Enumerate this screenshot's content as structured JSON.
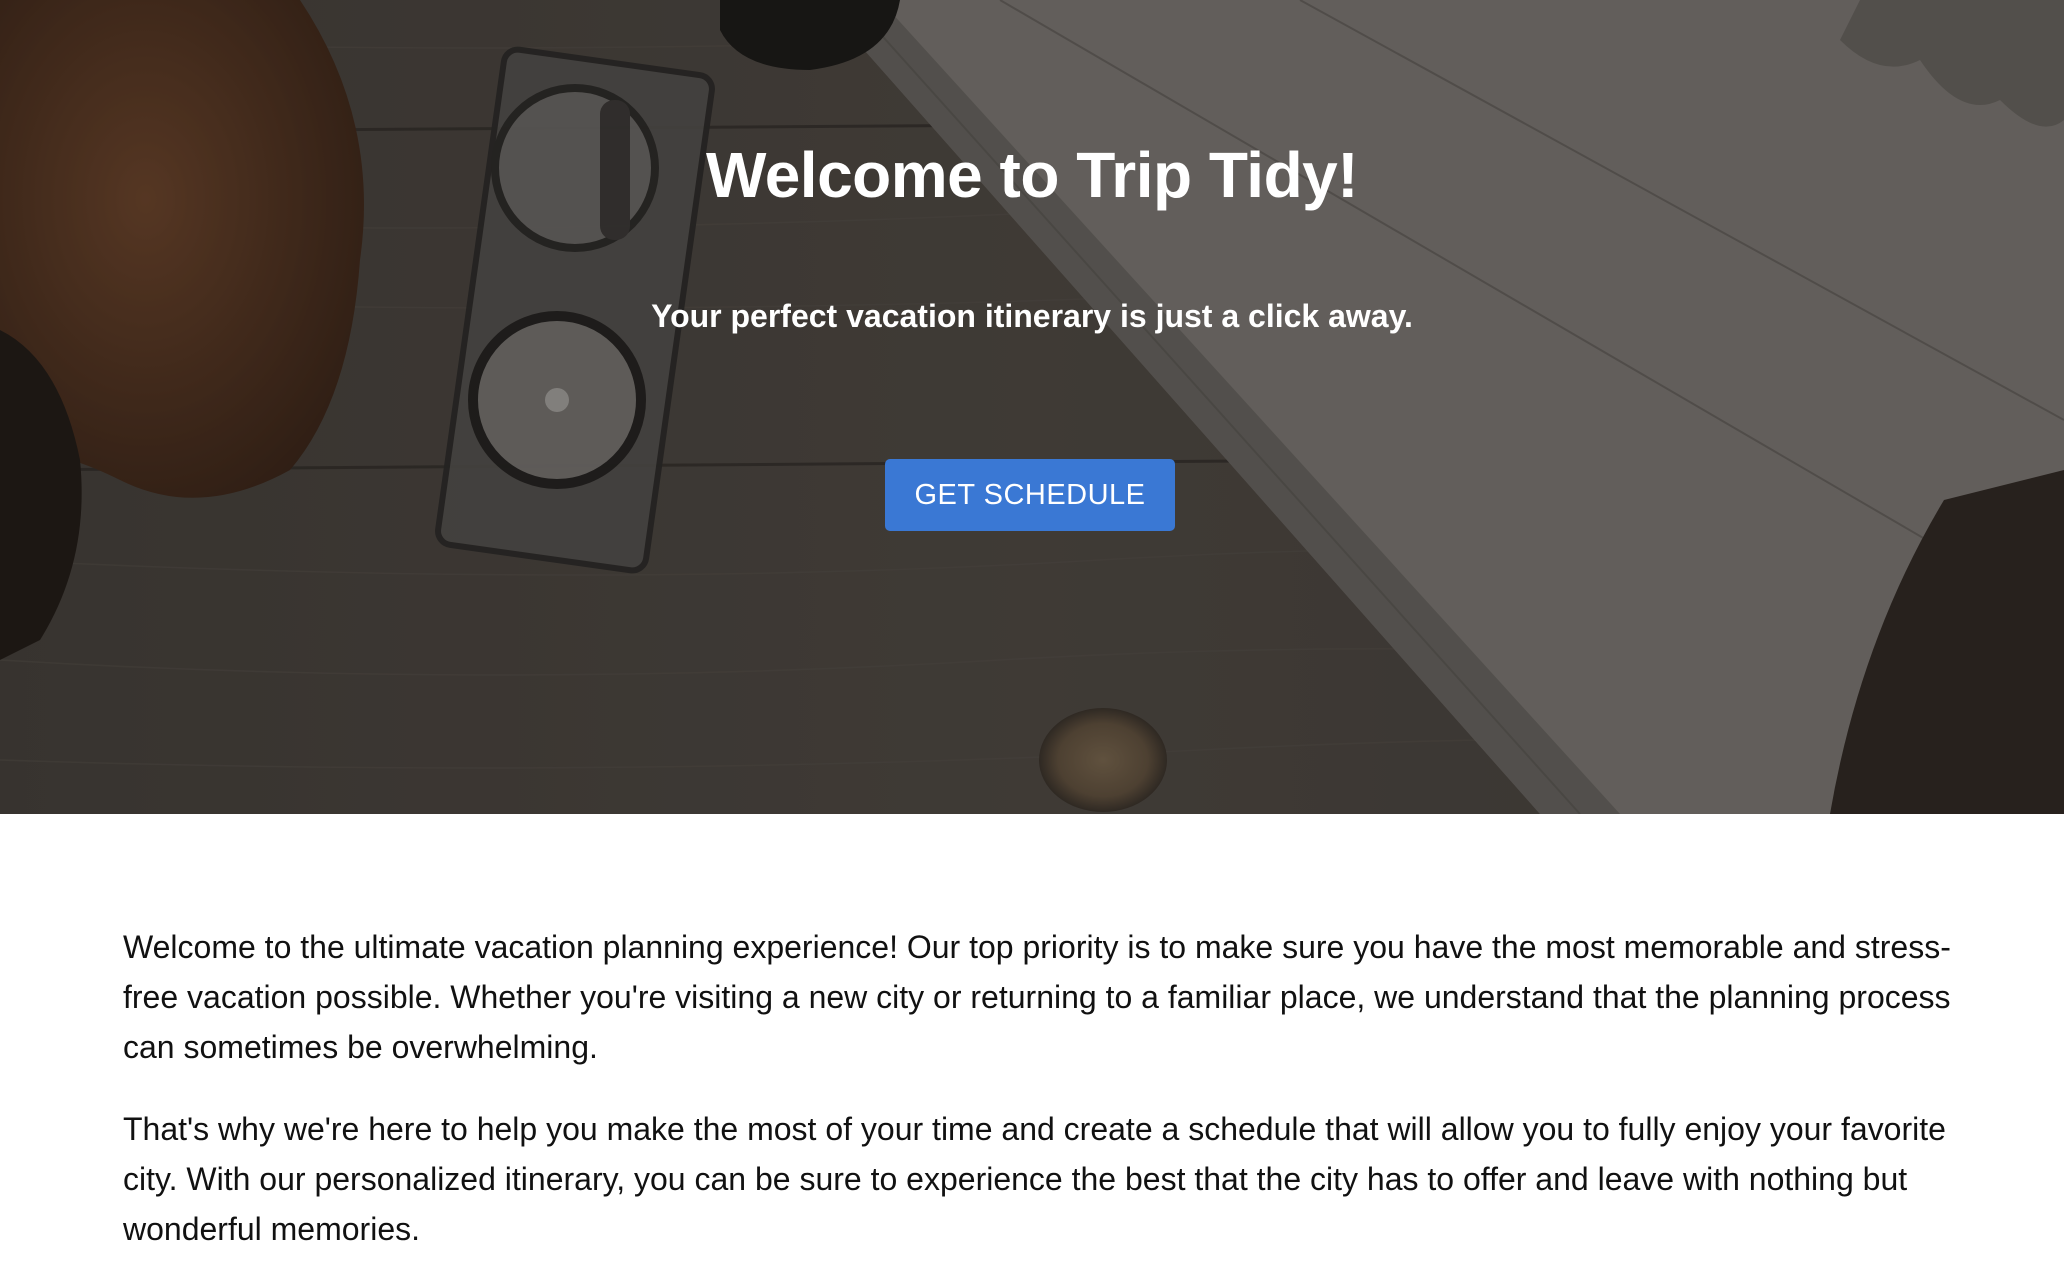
{
  "hero": {
    "title": "Welcome to Trip Tidy!",
    "subtitle": "Your perfect vacation itinerary is just a click away.",
    "cta_label": "GET SCHEDULE"
  },
  "intro": {
    "paragraphs": [
      "Welcome to the ultimate vacation planning experience! Our top priority is to make sure you have the most memorable and stress-free vacation possible. Whether you're visiting a new city or returning to a familiar place, we understand that the planning process can sometimes be overwhelming.",
      "That's why we're here to help you make the most of your time and create a schedule that will allow you to fully enjoy your favorite city. With our personalized itinerary, you can be sure to experience the best that the city has to offer and leave with nothing but wonderful memories."
    ]
  },
  "colors": {
    "cta": "#3a78d4",
    "hero_overlay": "#2a2724",
    "text": "#111111"
  }
}
